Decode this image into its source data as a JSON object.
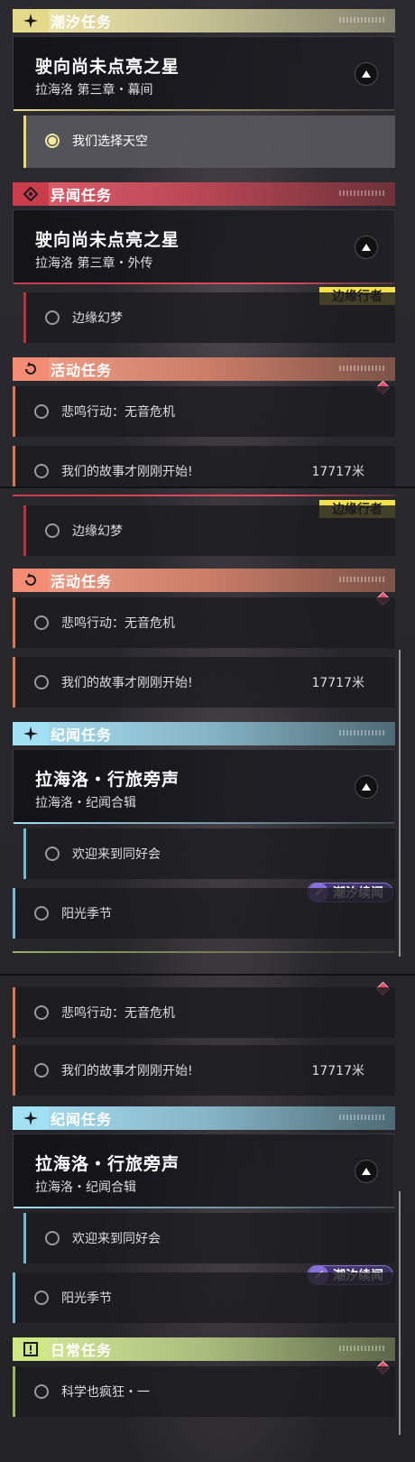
{
  "accent": {
    "tide": "#e4d98a",
    "anomaly": "#c83c4c",
    "activity": "#f28c72",
    "chronicle": "#a2e0f4",
    "daily": "#cde884",
    "edge_tag": "#f4e24a",
    "tide_tag": "#8a6fd8"
  },
  "panel1": {
    "tide_cat": {
      "title": "潮汐任务",
      "icon": "sparkle-icon"
    },
    "tide_quest": {
      "title": "驶向尚未点亮之星",
      "sub": "拉海洛 第三章・幕间"
    },
    "tide_obj": "我们选择天空",
    "anomaly_cat": {
      "title": "异闻任务",
      "icon": "crosshair-icon"
    },
    "anomaly_quest": {
      "title": "驶向尚未点亮之星",
      "sub": "拉海洛 第三章・外传"
    },
    "edge_tag": "边缘行者",
    "anomaly_obj": "边缘幻梦",
    "activity_cat": {
      "title": "活动任务",
      "icon": "cycle-icon"
    },
    "activity_obj1": "悲鸣行动：无音危机",
    "activity_obj2": "我们的故事才刚刚开始!",
    "activity_dist": "17717米"
  },
  "panel2": {
    "edge_tag": "边缘行者",
    "anomaly_obj": "边缘幻梦",
    "activity_cat": {
      "title": "活动任务",
      "icon": "cycle-icon"
    },
    "activity_obj1": "悲鸣行动：无音危机",
    "activity_obj2": "我们的故事才刚刚开始!",
    "activity_dist": "17717米",
    "chron_cat": {
      "title": "纪闻任务",
      "icon": "sparkle-icon"
    },
    "chron_quest": {
      "title": "拉海洛・行旅旁声",
      "sub": "拉海洛・纪闻合辑"
    },
    "chron_obj1": "欢迎来到同好会",
    "tide_tag": "潮汐续闻",
    "chron_obj2": "阳光季节"
  },
  "panel3": {
    "activity_obj1": "悲鸣行动：无音危机",
    "activity_obj2": "我们的故事才刚刚开始!",
    "activity_dist": "17717米",
    "chron_cat": {
      "title": "纪闻任务",
      "icon": "sparkle-icon"
    },
    "chron_quest": {
      "title": "拉海洛・行旅旁声",
      "sub": "拉海洛・纪闻合辑"
    },
    "chron_obj1": "欢迎来到同好会",
    "tide_tag": "潮汐续闻",
    "chron_obj2": "阳光季节",
    "daily_cat": {
      "title": "日常任务",
      "icon": "exclamation-icon"
    },
    "daily_obj1": "科学也疯狂・一"
  }
}
